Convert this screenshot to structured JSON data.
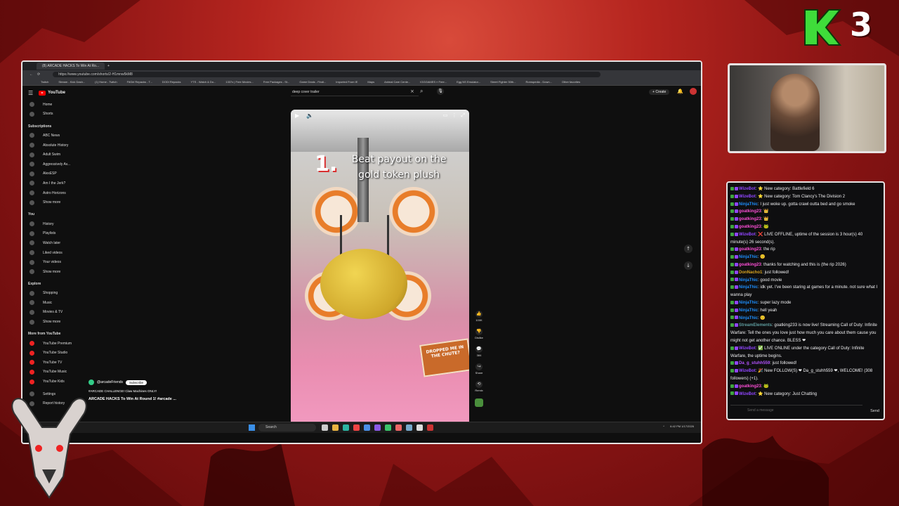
{
  "branding": {
    "logo_number": "3",
    "accent": "#3fdc3a"
  },
  "browser": {
    "tab_title": "(8) ARCADE HACKS To Win At Ro...",
    "url": "https://www.youtube.com/shorts/2-H1mnw5kM8",
    "bookmarks": [
      "Twitch",
      "Stream - Kick Dash...",
      "(1) Home - Twitch",
      "FitGirl Repacks - T...",
      "DODI Repacks",
      "YTS - Watch & Do...",
      "1337x | Free Movies...",
      "Free Packages - St...",
      "Game Deals - Findi...",
      "Imported From IE",
      "Maps",
      "Animal Care Cente...",
      "IGGGAMES » Free...",
      "Egg NS Emulator...",
      "Street Fighter 30th...",
      "Romspedia - Down...",
      "Other favorites"
    ]
  },
  "youtube": {
    "logo": "YouTube",
    "search_value": "deep cover trailer",
    "create_label": "Create",
    "sidebar": {
      "top": [
        {
          "label": "Home",
          "icon": "home-icon"
        },
        {
          "label": "Shorts",
          "icon": "shorts-icon"
        }
      ],
      "subscriptions_header": "Subscriptions",
      "subscriptions": [
        "ABC News",
        "Absolute History",
        "Adult Swim",
        "Aggressively Av...",
        "AlexESP",
        "Am I the Jerk?",
        "Astro Horizons",
        "Show more"
      ],
      "you_header": "You",
      "you": [
        "History",
        "Playlists",
        "Watch later",
        "Liked videos",
        "Your videos",
        "Show more"
      ],
      "explore_header": "Explore",
      "explore": [
        "Shopping",
        "Music",
        "Movies & TV",
        "Show more"
      ],
      "more_header": "More from YouTube",
      "more": [
        "YouTube Premium",
        "YouTube Studio",
        "YouTube TV",
        "YouTube Music",
        "YouTube Kids"
      ],
      "bottom": [
        "Settings",
        "Report history"
      ]
    },
    "short": {
      "caption_number": "1.",
      "caption_text": "Beat payout on the gold token plush",
      "sign_text": "DROPPED ME IN THE CHUTE?",
      "channel": "@arcadeFriends",
      "subscribe_label": "Subscribe",
      "description": "#ARCADE CHALLENGE! Claw Machines ONLY!",
      "title": "ARCADE HACKS To Win At Round 1! #arcade ...",
      "progress": 0.02
    },
    "actions": [
      {
        "icon": "like-icon",
        "label": "100K"
      },
      {
        "icon": "dislike-icon",
        "label": "Dislike"
      },
      {
        "icon": "comment-icon",
        "label": "384"
      },
      {
        "icon": "share-icon",
        "label": "Share"
      },
      {
        "icon": "remix-icon",
        "label": "Remix"
      }
    ]
  },
  "taskbar": {
    "search_placeholder": "Search",
    "time": "6:42 PM",
    "date": "1/17/2026"
  },
  "chat": {
    "messages": [
      {
        "user": "WizeBot",
        "color": "#9146ff",
        "text": "⭐ New category: Battlefield 6"
      },
      {
        "user": "WizeBot",
        "color": "#9146ff",
        "text": "⭐ New category: Tom Clancy's The Division 2"
      },
      {
        "user": "NinjaThic",
        "color": "#1e90ff",
        "text": "I just woke up. gotta crawl outta bed and go smoke"
      },
      {
        "user": "goatking23",
        "color": "#ff4fd8",
        "text": "👑"
      },
      {
        "user": "goatking23",
        "color": "#ff4fd8",
        "text": "👑"
      },
      {
        "user": "goatking23",
        "color": "#ff4fd8",
        "text": "🐸"
      },
      {
        "user": "WizeBot",
        "color": "#9146ff",
        "text": "❌ LIVE OFFLINE, uptime of the session is 3 hour(s) 40 minute(s) 26 second(s)."
      },
      {
        "user": "goatking23",
        "color": "#ff4fd8",
        "text": "the rip"
      },
      {
        "user": "NinjaThic",
        "color": "#1e90ff",
        "text": "🙂"
      },
      {
        "user": "goatking23",
        "color": "#ff4fd8",
        "text": "thanks for watching and this is (the rip 2026)"
      },
      {
        "user": "DonNacho1",
        "color": "#daa520",
        "text": "just followed!"
      },
      {
        "user": "NinjaThic",
        "color": "#1e90ff",
        "text": "good movie"
      },
      {
        "user": "NinjaThic",
        "color": "#1e90ff",
        "text": "idk yet. I've been staring at games for a minute. not sure what I wanna play"
      },
      {
        "user": "NinjaThic",
        "color": "#1e90ff",
        "text": "super lazy mode"
      },
      {
        "user": "NinjaThic",
        "color": "#1e90ff",
        "text": "hell yeah"
      },
      {
        "user": "NinjaThic",
        "color": "#1e90ff",
        "text": "🙂"
      },
      {
        "user": "StreamElements",
        "color": "#5f9ea0",
        "text": "goatking233 is now live! Streaming Call of Duty: Infinite Warfare: Tell the ones you love just how much you care about them cause you might not get another chance. BLESS ❤"
      },
      {
        "user": "WizeBot",
        "color": "#9146ff",
        "text": "✅ LIVE ONLINE under the category Call of Duty: Infinite Warfare, the uptime begins."
      },
      {
        "user": "Da_g_stuhh559",
        "color": "#b452ff",
        "text": "just followed!"
      },
      {
        "user": "WizeBot",
        "color": "#9146ff",
        "text": "🎉 New FOLLOW(S) ❤ Da_g_stuhh559 ❤, WELCOME! (308 followers) (+1)."
      },
      {
        "user": "goatking23",
        "color": "#ff4fd8",
        "text": "🐸"
      },
      {
        "user": "WizeBot",
        "color": "#9146ff",
        "text": "⭐ New category: Just Chatting"
      }
    ],
    "input_placeholder": "Send a message",
    "send_label": "Send"
  }
}
